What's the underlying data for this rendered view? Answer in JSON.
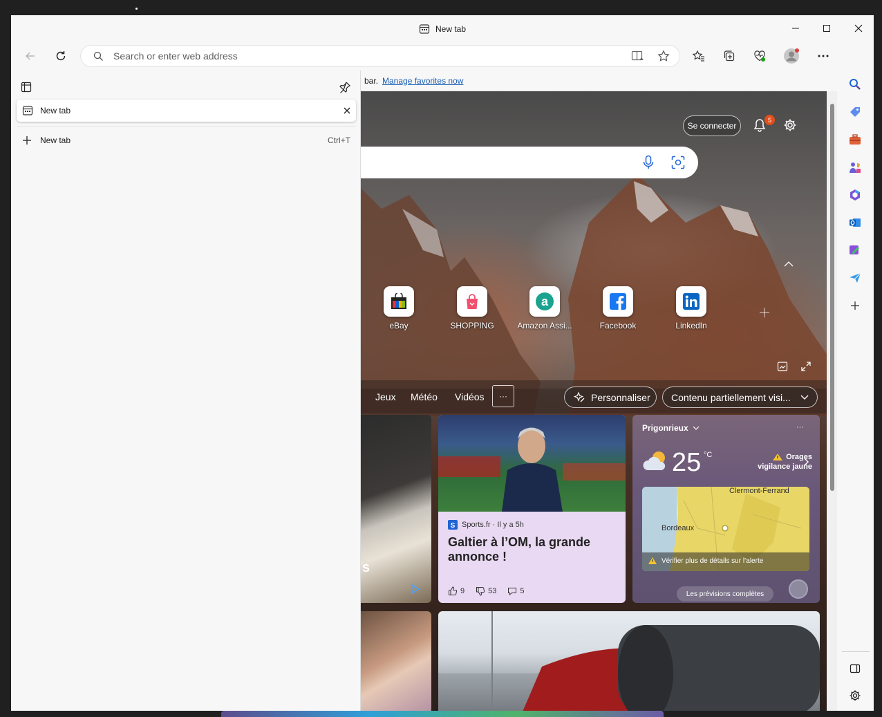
{
  "window": {
    "title": "New tab",
    "address_placeholder": "Search or enter web address"
  },
  "favorites_bar": {
    "prefix_text": "bar.",
    "link_text": "Manage favorites now"
  },
  "tab_panel": {
    "tabs": [
      {
        "label": "New tab"
      }
    ],
    "new_tab_label": "New tab",
    "new_tab_shortcut": "Ctrl+T"
  },
  "page": {
    "sign_in_label": "Se connecter",
    "notification_count": "5",
    "quick_links": [
      {
        "label": "eBay",
        "icon": "ebay-icon"
      },
      {
        "label": "SHOPPING",
        "icon": "shopping-bag-icon"
      },
      {
        "label": "Amazon Assi...",
        "icon": "amazon-assistant-icon"
      },
      {
        "label": "Facebook",
        "icon": "facebook-icon"
      },
      {
        "label": "LinkedIn",
        "icon": "linkedin-icon"
      }
    ],
    "nav_links": [
      "Jeux",
      "Météo",
      "Vidéos"
    ],
    "more_label": "···",
    "personalize_label": "Personnaliser",
    "content_dropdown_label": "Contenu partiellement visi...",
    "news_card": {
      "source": "Sports.fr · Il y a 5h",
      "headline": "Galtier à l’OM, la grande annonce !",
      "likes": "9",
      "dislikes": "53",
      "comments": "5"
    },
    "left_card_partial_text": "s",
    "weather": {
      "location": "Prigonrieux",
      "temperature": "25",
      "unit": "°C",
      "alert_title": "Orages",
      "alert_subtitle": "vigilance jaune",
      "map_city_1": "Clermont-Ferrand",
      "map_city_2": "Bordeaux",
      "alert_detail": "Vérifier plus de détails sur l’alerte",
      "full_forecast_label": "Les prévisions complètes",
      "menu_label": "···"
    }
  },
  "colors": {
    "accent": "#0f6cbd",
    "badge": "#e34f1a",
    "news_card_bg": "#e9d9f2",
    "weather_card_bg": "#6e5a7c"
  }
}
